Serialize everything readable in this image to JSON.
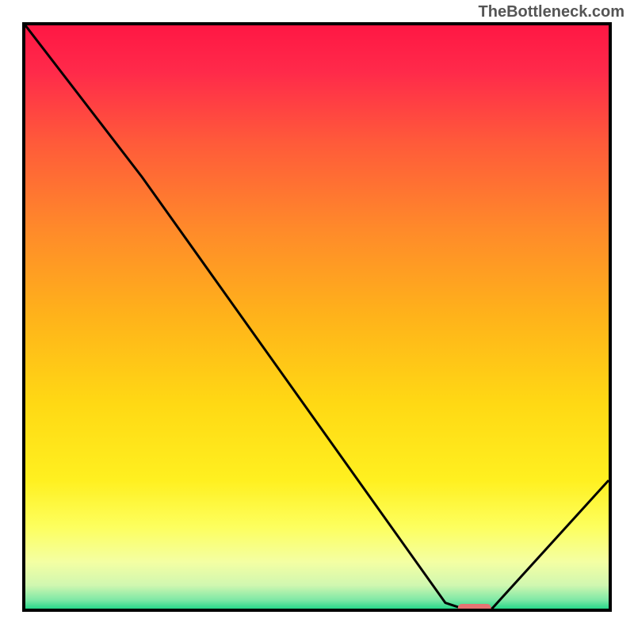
{
  "watermark": "TheBottleneck.com",
  "chart_data": {
    "type": "line",
    "title": "",
    "xlabel": "",
    "ylabel": "",
    "xlim": [
      0,
      100
    ],
    "ylim": [
      0,
      100
    ],
    "series": [
      {
        "name": "bottleneck-curve",
        "x": [
          0,
          20,
          72,
          75,
          80,
          100
        ],
        "y": [
          100,
          74,
          1,
          0,
          0,
          22
        ]
      }
    ],
    "marker": {
      "name": "optimal-point",
      "x": 77,
      "y": 0,
      "color": "#e57373"
    },
    "gradient_stops": [
      {
        "offset": 0.0,
        "color": "#ff1744"
      },
      {
        "offset": 0.08,
        "color": "#ff2a4a"
      },
      {
        "offset": 0.2,
        "color": "#ff5a3a"
      },
      {
        "offset": 0.35,
        "color": "#ff8a2a"
      },
      {
        "offset": 0.5,
        "color": "#ffb31a"
      },
      {
        "offset": 0.65,
        "color": "#ffd914"
      },
      {
        "offset": 0.78,
        "color": "#fff020"
      },
      {
        "offset": 0.86,
        "color": "#fdff5e"
      },
      {
        "offset": 0.92,
        "color": "#f4ffa3"
      },
      {
        "offset": 0.96,
        "color": "#d0f7b0"
      },
      {
        "offset": 0.985,
        "color": "#7fe8a6"
      },
      {
        "offset": 1.0,
        "color": "#27d88a"
      }
    ]
  }
}
